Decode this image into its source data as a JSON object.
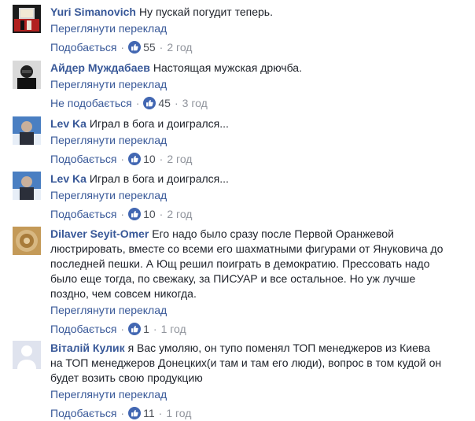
{
  "comments": [
    {
      "author": "Yuri Simanovich",
      "text": "Ну пускай погудит теперь.",
      "translate": "Переглянути переклад",
      "like": "Подобається",
      "count": "55",
      "age": "2 год",
      "avatar": "avatar-red-dark"
    },
    {
      "author": "Айдер Муждабаев",
      "text": "Настоящая мужская дрючба.",
      "translate": "Переглянути переклад",
      "like": "Не подобається",
      "count": "45",
      "age": "3 год",
      "avatar": "avatar-bw-portrait"
    },
    {
      "author": "Lev Ka",
      "text": "Играл в бога и доигрался...",
      "translate": "Переглянути переклад",
      "like": "Подобається",
      "count": "10",
      "age": "2 год",
      "avatar": "avatar-person-sky"
    },
    {
      "author": "Lev Ka",
      "text": "Играл в бога и доигрался...",
      "translate": "Переглянути переклад",
      "like": "Подобається",
      "count": "10",
      "age": "2 год",
      "avatar": "avatar-person-sky"
    },
    {
      "author": "Dilaver Seyit-Omer",
      "text_lines": [
        "Его надо было сразу после Первой Оранжевой",
        "люстрировать, вместе со всеми его шахматными фигурами от Януковича до",
        "последней пешки. А Ющ решил поиграть в демократию. Прессовать надо",
        "было еще тогда, по свежаку, за ПИСУАР и все остальное. Но уж лучше",
        "поздно, чем совсем никогда."
      ],
      "translate": "Переглянути переклад",
      "like": "Подобається",
      "count": "1",
      "age": "1 год",
      "avatar": "avatar-ornament"
    },
    {
      "author": "Віталій Кулик",
      "text_lines": [
        "я Вас умоляю, он тупо поменял ТОП менеджеров из Киева",
        "на ТОП менеджеров Донецких(и там и там его люди), вопрос в том кудой он",
        "будет возить свою продукцию"
      ],
      "translate": "Переглянути переклад",
      "like": "Подобається",
      "count": "11",
      "age": "1 год",
      "avatar": "avatar-default-silhouette"
    }
  ],
  "colors": {
    "link": "#385898",
    "meta": "#90949c",
    "text": "#1d2129",
    "reaction": "#4267b2"
  },
  "icons": {
    "reaction": "thumbs-up-icon"
  }
}
